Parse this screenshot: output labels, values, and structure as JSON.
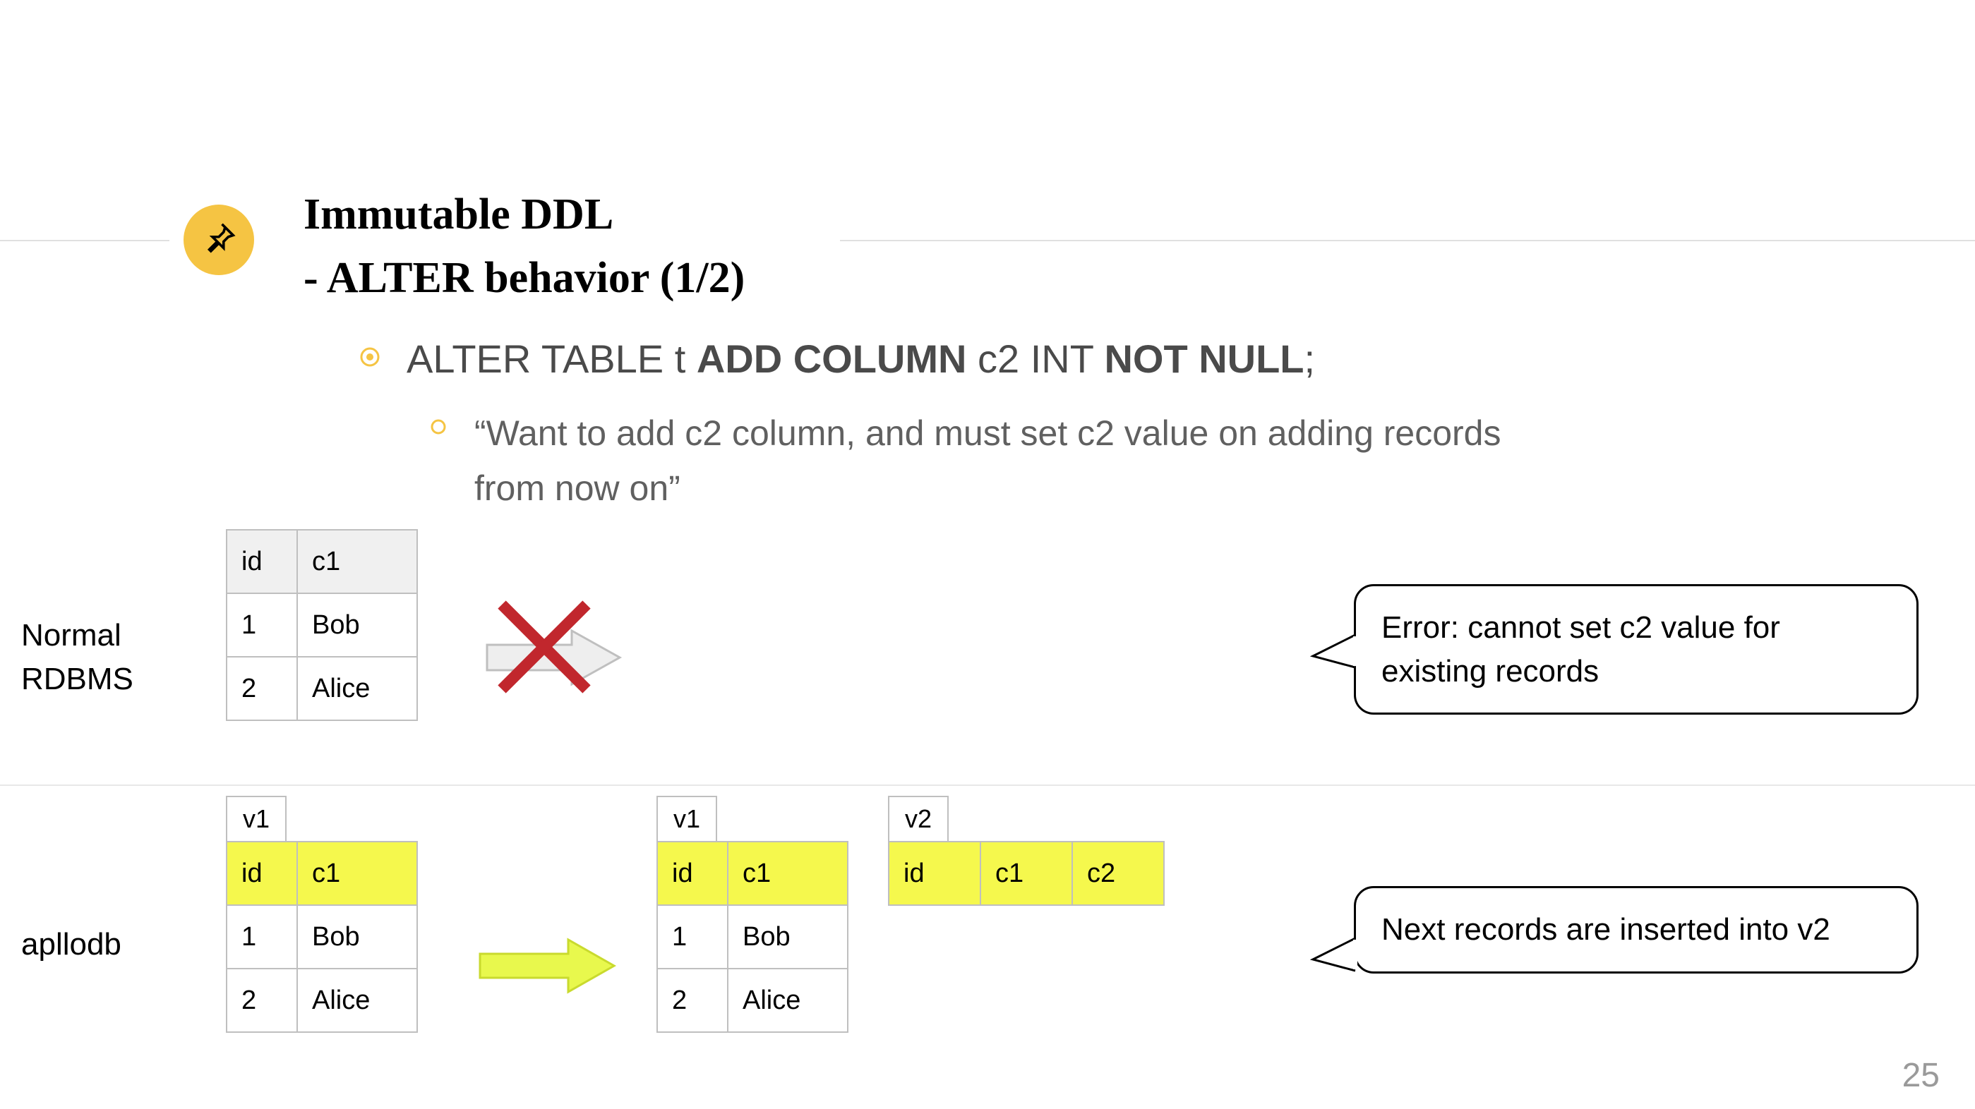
{
  "title": {
    "line1": "Immutable DDL",
    "line2": "- ALTER behavior (1/2)"
  },
  "bullet_main": "ALTER TABLE t ADD COLUMN c2 INT NOT NULL;",
  "bullet_main_parts": {
    "p1": "ALTER TABLE t ",
    "p2": "ADD COLUMN",
    "p3": " c2 INT ",
    "p4": "NOT NULL",
    "p5": ";"
  },
  "bullet_sub": "“Want to add c2 column, and must set c2 value on adding records from now on”",
  "section_normal": "Normal RDBMS",
  "section_apllodb": "apllodb",
  "table_normal": {
    "headers": [
      "id",
      "c1"
    ],
    "rows": [
      [
        "1",
        "Bob"
      ],
      [
        "2",
        "Alice"
      ]
    ]
  },
  "v1_label": "v1",
  "v2_label": "v2",
  "table_ap_v1": {
    "headers": [
      "id",
      "c1"
    ],
    "rows": [
      [
        "1",
        "Bob"
      ],
      [
        "2",
        "Alice"
      ]
    ]
  },
  "table_ap_v1b": {
    "headers": [
      "id",
      "c1"
    ],
    "rows": [
      [
        "1",
        "Bob"
      ],
      [
        "2",
        "Alice"
      ]
    ]
  },
  "table_ap_v2": {
    "headers": [
      "id",
      "c1",
      "c2"
    ]
  },
  "callout_error": "Error: cannot set c2 value for existing records",
  "callout_next": "Next records are inserted into v2",
  "page_number": "25"
}
